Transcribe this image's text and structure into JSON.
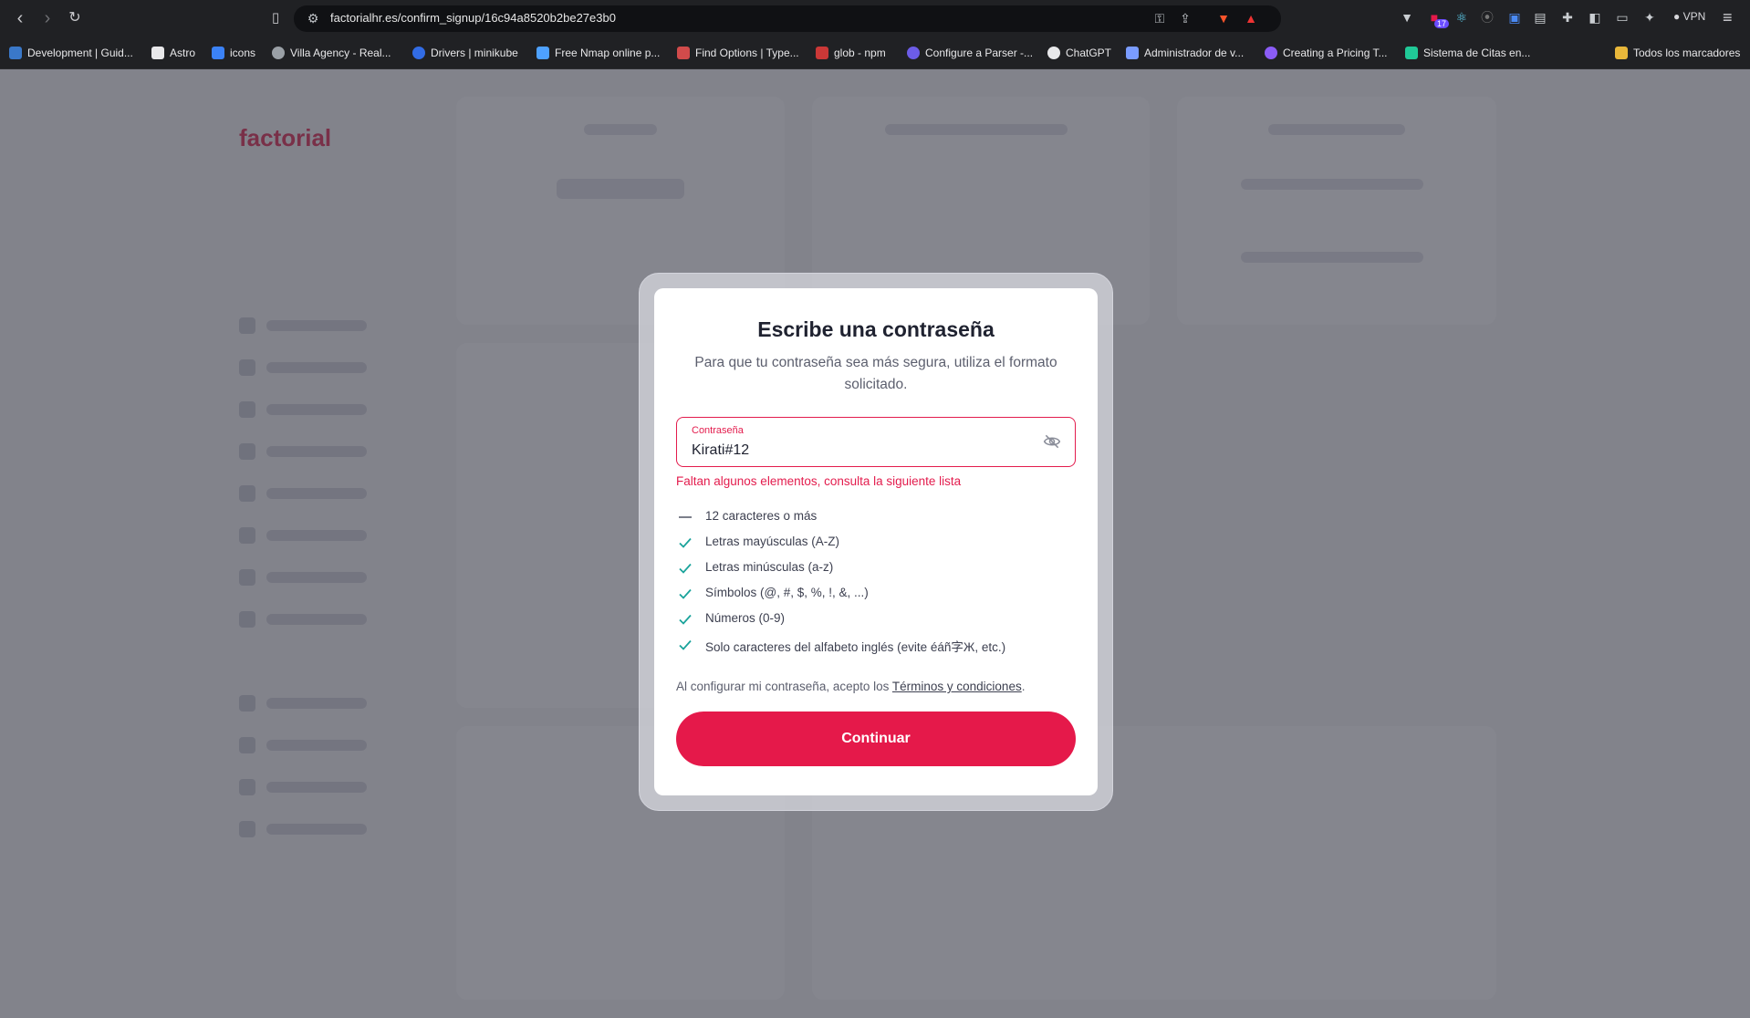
{
  "browser": {
    "url": "factorialhr.es/confirm_signup/16c94a8520b2be27e3b0",
    "vpn_label": "VPN",
    "ext_badge": "17",
    "bookmarks": [
      {
        "label": "Development | Guid...",
        "color": "#3a78c9"
      },
      {
        "label": "Astro",
        "color": "#e8e8ea"
      },
      {
        "label": "icons",
        "color": "#3b82f6"
      },
      {
        "label": "Villa Agency - Real...",
        "color": "#9aa0a6"
      },
      {
        "label": "Drivers | minikube",
        "color": "#326ce5"
      },
      {
        "label": "Free Nmap online p...",
        "color": "#4ea1ff"
      },
      {
        "label": "Find Options | Type...",
        "color": "#d14b4b"
      },
      {
        "label": "glob - npm",
        "color": "#cb3837"
      },
      {
        "label": "Configure a Parser -...",
        "color": "#6c5ce7"
      },
      {
        "label": "ChatGPT",
        "color": "#e8e8ea"
      },
      {
        "label": "Administrador de v...",
        "color": "#7a9cff"
      },
      {
        "label": "Creating a Pricing T...",
        "color": "#8b5cf6"
      },
      {
        "label": "Sistema de Citas en...",
        "color": "#20c997"
      }
    ],
    "all_bookmarks": "Todos los marcadores"
  },
  "modal": {
    "title": "Escribe una contraseña",
    "subtitle": "Para que tu contraseña sea más segura, utiliza el formato solicitado.",
    "field_label": "Contraseña",
    "field_value": "Kirati#12",
    "error": "Faltan algunos elementos, consulta la siguiente lista",
    "rules": [
      {
        "text": "12 caracteres o más",
        "met": false
      },
      {
        "text": "Letras mayúsculas (A-Z)",
        "met": true
      },
      {
        "text": "Letras minúsculas (a-z)",
        "met": true
      },
      {
        "text": "Símbolos (@, #, $, %, !, &, ...)",
        "met": true
      },
      {
        "text": "Números (0-9)",
        "met": true
      },
      {
        "text": "Solo caracteres del alfabeto inglés (evite éáñ字Ж, etc.)",
        "met": true
      }
    ],
    "terms_prefix": "Al configurar mi contraseña, acepto los ",
    "terms_link": "Términos y condiciones",
    "terms_suffix": ".",
    "continue_label": "Continuar"
  },
  "colors": {
    "accent": "#e5194a",
    "check": "#1aa39b"
  },
  "background": {
    "logo": "factorial"
  }
}
